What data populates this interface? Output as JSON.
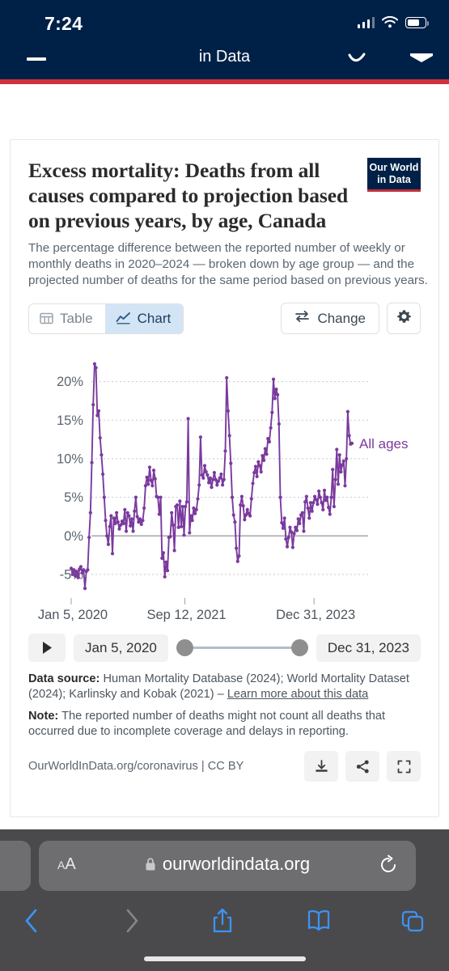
{
  "status_bar": {
    "time": "7:24",
    "icons": [
      "cellular-signal-icon",
      "wifi-icon",
      "battery-icon"
    ]
  },
  "site_nav": {
    "title": "in Data",
    "menu_icon": "hamburger-icon",
    "right_icons": [
      "squiggle-icon",
      "envelope-icon"
    ],
    "accent_color": "#002147",
    "rule_color": "#d0323c"
  },
  "chart": {
    "title": "Excess mortality: Deaths from all causes compared to projection based on previous years, by age, Canada",
    "logo_line1": "Our World",
    "logo_line2": "in Data",
    "subtitle": "The percentage difference between the reported number of weekly or monthly deaths in 2020–2024 — broken down by age group — and the projected number of deaths for the same period based on previous years.",
    "tabs": [
      {
        "label": "Table",
        "icon": "table-icon",
        "active": false
      },
      {
        "label": "Chart",
        "icon": "line-chart-icon",
        "active": true
      }
    ],
    "change_button": {
      "label": "Change",
      "icon": "swap-arrows-icon"
    },
    "settings_button": {
      "icon": "gear-icon"
    },
    "series_label": "All ages",
    "series_color": "#7a3a9e"
  },
  "timeline": {
    "play_label": "play-icon",
    "start_date": "Jan 5, 2020",
    "end_date": "Dec 31, 2023"
  },
  "footer": {
    "source_label": "Data source:",
    "source_text": "Human Mortality Database (2024); World Mortality Dataset (2024); Karlinsky and Kobak (2021) – ",
    "source_link": "Learn more about this data",
    "note_label": "Note:",
    "note_text": "The reported number of deaths might not count all deaths that occurred due to incomplete coverage and delays in reporting.",
    "license": "OurWorldInData.org/coronavirus | CC BY",
    "actions": [
      "download-icon",
      "share-icon",
      "expand-icon"
    ]
  },
  "browser": {
    "font_size_label": "A",
    "font_size_label_small": "A",
    "url": "ourworldindata.org",
    "lock_icon": "lock-icon",
    "reload_icon": "reload-icon",
    "toolbar": [
      "back-icon",
      "forward-icon",
      "share-icon",
      "bookmarks-icon",
      "tabs-icon"
    ]
  },
  "chart_data": {
    "type": "line",
    "title": "Excess mortality: Deaths from all causes compared to projection based on previous years, by age, Canada",
    "xlabel": "",
    "ylabel": "",
    "ylim": [
      -7,
      23
    ],
    "xlim": [
      "Jan 5, 2020",
      "Dec 31, 2023"
    ],
    "ytick_labels": [
      "-5%",
      "0%",
      "5%",
      "10%",
      "15%",
      "20%"
    ],
    "ytick_values": [
      -5,
      0,
      5,
      10,
      15,
      20
    ],
    "xtick_labels": [
      "Jan 5, 2020",
      "Sep 12, 2021",
      "Dec 31, 2023"
    ],
    "grid": "horizontal-dotted",
    "legend": "inline-end-label",
    "series": [
      {
        "name": "All ages",
        "color": "#7a3a9e",
        "values": [
          -4.2,
          -5.0,
          -4.4,
          -5.2,
          -4.6,
          -5.4,
          -4.3,
          -4.0,
          -4.8,
          -4.4,
          -6.8,
          -4.6,
          -4.4,
          -0.2,
          3.0,
          9.5,
          17.0,
          22.3,
          21.8,
          15.6,
          16.2,
          12.7,
          10.5,
          8.0,
          5.0,
          2.0,
          0.0,
          -1.1,
          1.2,
          2.6,
          -2.3,
          2.3,
          1.6,
          3.0,
          1.8,
          0.9,
          1.4,
          1.9,
          1.6,
          3.4,
          0.6,
          3.0,
          2.6,
          1.3,
          2.2,
          0.6,
          3.2,
          5.0,
          2.5,
          1.8,
          2.2,
          1.5,
          2.0,
          3.6,
          6.5,
          7.6,
          6.7,
          8.9,
          7.2,
          6.5,
          8.5,
          7.4,
          5.1,
          5.0,
          2.8,
          5.0,
          -2.9,
          -2.2,
          -5.3,
          -3.4,
          -4.5,
          -0.2,
          -0.1,
          3.0,
          1.4,
          -1.9,
          3.8,
          4.0,
          1.1,
          4.5,
          1.2,
          3.8,
          0.1,
          3.8,
          4.4,
          15.2,
          0.4,
          2.6,
          2.0,
          3.6,
          2.9,
          3.4,
          4.8,
          6.6,
          12.8,
          7.9,
          7.5,
          9.1,
          8.3,
          7.9,
          6.9,
          7.5,
          6.3,
          7.3,
          8.2,
          7.3,
          6.6,
          7.1,
          7.5,
          8.0,
          6.6,
          7.3,
          11.0,
          20.5,
          16.2,
          13.0,
          9.4,
          5.0,
          2.7,
          1.8,
          -1.6,
          -3.3,
          -2.6,
          4.0,
          5.1,
          3.9,
          2.1,
          2.7,
          3.4,
          2.9,
          2.6,
          4.8,
          6.8,
          8.2,
          9.0,
          7.7,
          9.6,
          9.1,
          8.3,
          10.4,
          9.8,
          11.3,
          10.6,
          12.6,
          12.2,
          14.0,
          16.0,
          20.3,
          17.8,
          19.0,
          18.3,
          14.5,
          5.0,
          1.7,
          1.0,
          2.3,
          -0.4,
          -1.4,
          -0.2,
          1.1,
          0.5,
          -1.5,
          0.3,
          1.1,
          0.7,
          2.2,
          1.6,
          2.7,
          3.0,
          0.6,
          4.4,
          5.1,
          3.6,
          2.3,
          4.3,
          3.2,
          4.3,
          5.1,
          4.7,
          4.1,
          5.8,
          5.0,
          4.3,
          3.4,
          5.9,
          4.6,
          5.0,
          3.7,
          2.8,
          5.0,
          8.6,
          3.8,
          7.3,
          11.2,
          6.7,
          10.5,
          8.3,
          9.2,
          9.7,
          6.5,
          10.0,
          16.1,
          13.0,
          11.9,
          12.0
        ]
      }
    ]
  }
}
